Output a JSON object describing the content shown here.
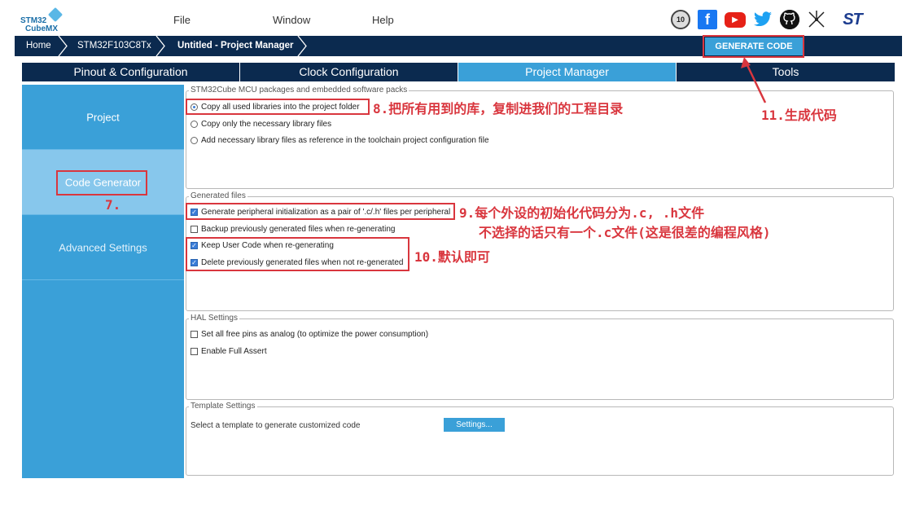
{
  "app": {
    "logo_line1": "STM32",
    "logo_line2": "CubeMX"
  },
  "menu": {
    "file": "File",
    "window": "Window",
    "help": "Help"
  },
  "top_icons": {
    "anniversary": "10",
    "facebook": "f",
    "youtube": "▶",
    "twitter": "🐦",
    "github": "⌥",
    "network": "⚹",
    "st_logo": "ST"
  },
  "breadcrumb": {
    "home": "Home",
    "device": "STM32F103C8Tx",
    "project": "Untitled - Project Manager"
  },
  "generate_button": "GENERATE CODE",
  "tabs": [
    {
      "label": "Pinout & Configuration"
    },
    {
      "label": "Clock Configuration"
    },
    {
      "label": "Project Manager"
    },
    {
      "label": "Tools"
    }
  ],
  "sidebar": {
    "items": [
      {
        "label": "Project"
      },
      {
        "label": "Code Generator"
      },
      {
        "label": "Advanced Settings"
      }
    ]
  },
  "packages": {
    "title": "STM32Cube MCU packages and embedded software packs",
    "options": [
      {
        "label": "Copy all used libraries into the project folder",
        "selected": true
      },
      {
        "label": "Copy only the necessary library files",
        "selected": false
      },
      {
        "label": "Add necessary library files as reference in the toolchain project configuration file",
        "selected": false
      }
    ]
  },
  "generated_files": {
    "title": "Generated files",
    "options": [
      {
        "label": "Generate peripheral initialization as a pair of '.c/.h' files per peripheral",
        "checked": true
      },
      {
        "label": "Backup previously generated files when re-generating",
        "checked": false
      },
      {
        "label": "Keep User Code when re-generating",
        "checked": true
      },
      {
        "label": "Delete previously generated files when not re-generated",
        "checked": true
      }
    ]
  },
  "hal_settings": {
    "title": "HAL Settings",
    "options": [
      {
        "label": "Set all free pins as analog (to optimize the power consumption)",
        "checked": false
      },
      {
        "label": "Enable Full Assert",
        "checked": false
      }
    ]
  },
  "template_settings": {
    "title": "Template Settings",
    "label": "Select a template to generate customized code",
    "button": "Settings..."
  },
  "annotations": {
    "a7": "7.",
    "a8": "8.把所有用到的库，复制进我们的工程目录",
    "a9_line1": "9.每个外设的初始化代码分为.c, .h文件",
    "a9_line2": "不选择的话只有一个.c文件(这是很差的编程风格)",
    "a10": "10.默认即可",
    "a11": "11.生成代码"
  },
  "colors": {
    "navy": "#0b2a4f",
    "accent": "#3aa0d8",
    "annotation_red": "#d9363e"
  }
}
